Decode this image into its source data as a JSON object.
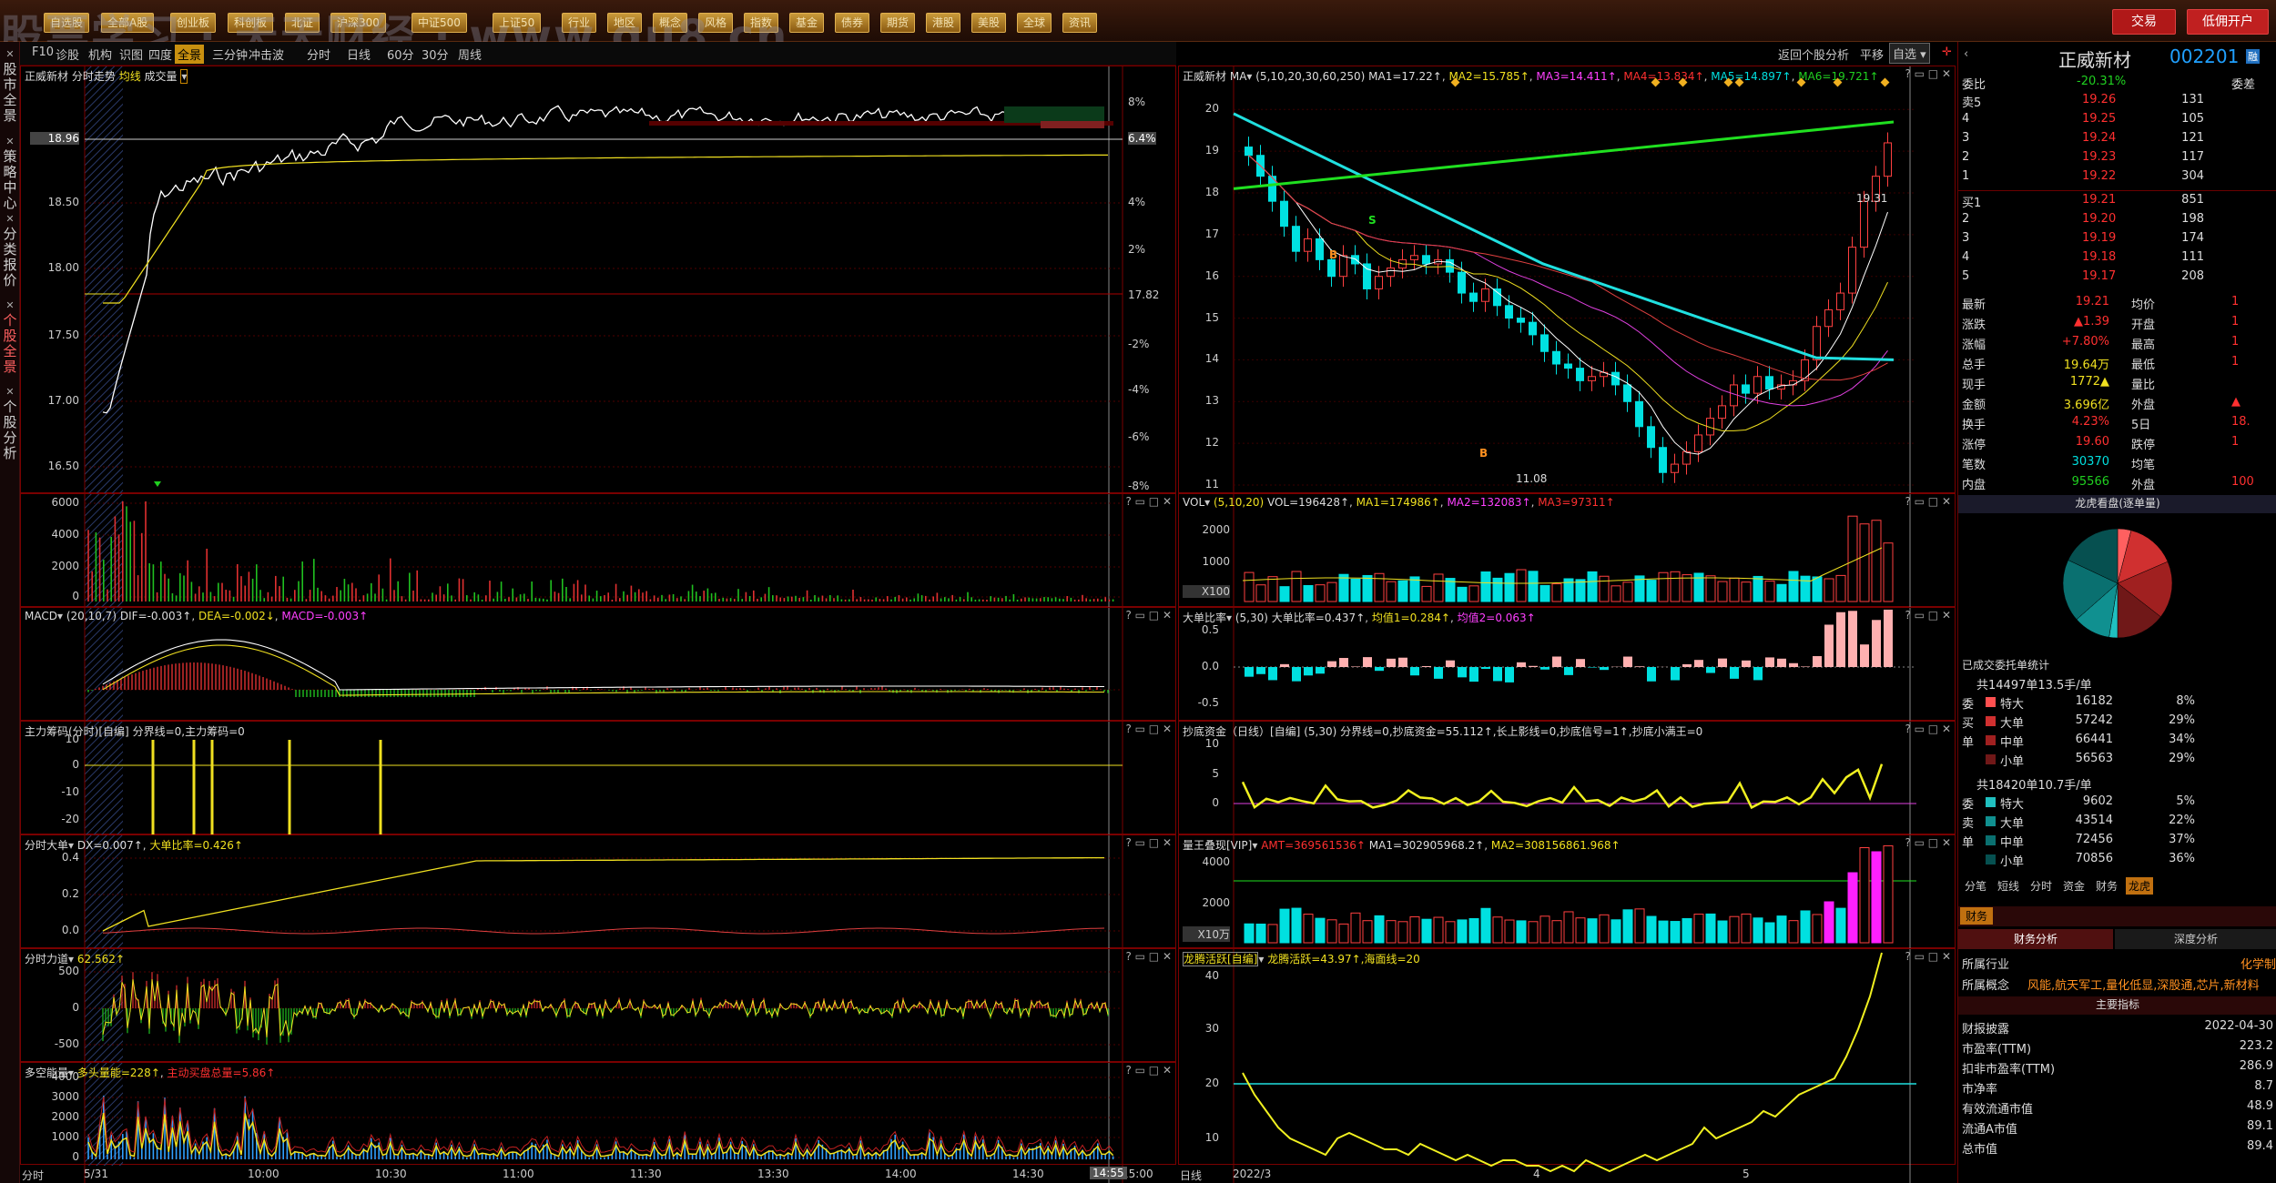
{
  "top": {
    "watermark": "股票学习 · 天天财经 · www.gu8.cn",
    "buttons": [
      "自选股",
      "全部A股",
      "创业板",
      "科创板",
      "北证",
      "沪深300",
      "中证500",
      "上证50",
      "行业",
      "地区",
      "概念",
      "风格",
      "指数",
      "基金",
      "债券",
      "期货",
      "港股",
      "美股",
      "全球",
      "资讯"
    ],
    "trade": "交易",
    "open_account": "低佣开户"
  },
  "sidebar": {
    "tabs": [
      "股市全景",
      "策略中心",
      "分类报价",
      "个股全景",
      "个股分析"
    ]
  },
  "subbar": {
    "items": [
      "F10",
      "诊股",
      "机构",
      "识图",
      "四度",
      "全景",
      "三分钟",
      "冲击波",
      "分时",
      "日线",
      "60分",
      "30分",
      "周线"
    ],
    "right": [
      "返回个股分析",
      "平移",
      "自选"
    ]
  },
  "left": {
    "main": {
      "title": "正威新材",
      "t1": "分时走势",
      "t2": "均线",
      "t3": "成交量",
      "ylabels": [
        "18.96",
        "18.50",
        "18.00",
        "17.50",
        "17.00",
        "16.50"
      ],
      "rlabels": [
        "8%",
        "6.4%",
        "4%",
        "2%",
        "17.82",
        "-2%",
        "-4%",
        "-6%",
        "-8%"
      ],
      "baseline": "17.82"
    },
    "vol": {
      "ylabels": [
        "6000",
        "4000",
        "2000",
        "0"
      ]
    },
    "macd": {
      "title": "MACD",
      "params": "(20,10,7)",
      "dif": "DIF=-0.003↑",
      "dea": "DEA=-0.002↓",
      "macd": "MACD=-0.003↑"
    },
    "zl": {
      "title": "主力筹码(分时)[自编]",
      "v": "分界线=0,主力筹码=0",
      "ylabels": [
        "10",
        "0",
        "-10",
        "-20"
      ]
    },
    "dd": {
      "title": "分时大单",
      "v1": "DX=0.007↑",
      "v2": "大单比率=0.426↑",
      "ylabels": [
        "0.4",
        "0.2",
        "0.0"
      ]
    },
    "ld": {
      "title": "分时力道",
      "v": "62.562↑",
      "ylabels": [
        "500",
        "0",
        "-500"
      ]
    },
    "dk": {
      "title": "多空能量",
      "v1": "多头量能=228↑",
      "v2": "主动买盘总量=5.86↑",
      "ylabels": [
        "4000",
        "3000",
        "2000",
        "1000",
        "0"
      ]
    },
    "xlabels": [
      "5/31",
      "10:00",
      "10:30",
      "11:00",
      "11:30",
      "13:30",
      "14:00",
      "14:30",
      "15:00"
    ],
    "time_cursor": "14:55",
    "mode": "分时"
  },
  "mid": {
    "kline": {
      "title": "正威新材",
      "ma": "MA",
      "params": "(5,10,20,30,60,250)",
      "ma1": "MA1=17.22↑",
      "ma2": "MA2=15.785↑",
      "ma3": "MA3=14.411↑",
      "ma4": "MA4=13.834↑",
      "ma5": "MA5=14.897↑",
      "ma6": "MA6=19.721↑",
      "ylabels": [
        "20",
        "19",
        "18",
        "17",
        "16",
        "15",
        "14",
        "13",
        "12",
        "11"
      ],
      "high": "19.31",
      "low": "11.08",
      "marks": [
        "B",
        "S",
        "B"
      ]
    },
    "vol": {
      "title": "VOL",
      "params": "(5,10,20)",
      "v": "VOL=196428↑",
      "ma1": "MA1=174986↑",
      "ma2": "MA2=132083↑",
      "ma3": "MA3=97311↑",
      "ylabels": [
        "2000",
        "1000",
        "X100"
      ]
    },
    "ddb": {
      "title": "大单比率",
      "params": "(5,30)",
      "v": "大单比率=0.437↑",
      "m1": "均值1=0.284↑",
      "m2": "均值2=0.063↑",
      "ylabels": [
        "0.5",
        "0.0",
        "-0.5"
      ]
    },
    "cd": {
      "title": "抄底资金（日线）[自编]",
      "params": "(5,30)",
      "v": "分界线=0,抄底资金=55.112↑,长上影线=0,抄底信号=1↑,抄底小满王=0",
      "ylabels": [
        "10",
        "5",
        "0"
      ]
    },
    "lw": {
      "title": "量王叠现[VIP]",
      "v1": "AMT=369561536↑",
      "v2": "MA1=302905968.2↑",
      "v3": "MA2=308156861.968↑",
      "ylabels": [
        "4000",
        "2000",
        "X10万"
      ]
    },
    "lt": {
      "title": "龙腾活跃[自编]",
      "v": "龙腾活跃=43.97↑,海面线=20",
      "ylabels": [
        "40",
        "30",
        "20",
        "10"
      ]
    },
    "xlabels": [
      "2022/3",
      "4",
      "5"
    ],
    "mode": "日线"
  },
  "right": {
    "name": "正威新材",
    "code": "002201",
    "wb_label": "委比",
    "wb": "-20.31%",
    "wc_label": "委差",
    "sell": [
      {
        "l": "卖5",
        "p": "19.26",
        "v": "131"
      },
      {
        "l": "4",
        "p": "19.25",
        "v": "105"
      },
      {
        "l": "3",
        "p": "19.24",
        "v": "121"
      },
      {
        "l": "2",
        "p": "19.23",
        "v": "117"
      },
      {
        "l": "1",
        "p": "19.22",
        "v": "304"
      }
    ],
    "buy": [
      {
        "l": "买1",
        "p": "19.21",
        "v": "851"
      },
      {
        "l": "2",
        "p": "19.20",
        "v": "198"
      },
      {
        "l": "3",
        "p": "19.19",
        "v": "174"
      },
      {
        "l": "4",
        "p": "19.18",
        "v": "111"
      },
      {
        "l": "5",
        "p": "19.17",
        "v": "208"
      }
    ],
    "quote": [
      [
        "最新",
        "19.21",
        "均价",
        "1"
      ],
      [
        "涨跌",
        "▲1.39",
        "开盘",
        "1"
      ],
      [
        "涨幅",
        "+7.80%",
        "最高",
        "1"
      ],
      [
        "总手",
        "19.64万",
        "最低",
        "1"
      ],
      [
        "现手",
        "1772▲",
        "量比",
        ""
      ],
      [
        "金额",
        "3.696亿",
        "外盘",
        "▲"
      ],
      [
        "换手",
        "4.23%",
        "5日",
        "18."
      ],
      [
        "涨停",
        "19.60",
        "跌停",
        "1"
      ],
      [
        "笔数",
        "30370",
        "均笔",
        ""
      ],
      [
        "内盘",
        "95566",
        "外盘",
        "100"
      ]
    ],
    "pie_title": "龙虎看盘(逐单量)",
    "pie": [
      {
        "name": "委托特大",
        "value": 8,
        "color": "#ff6060"
      },
      {
        "name": "委托大单",
        "value": 29,
        "color": "#d03030"
      },
      {
        "name": "委托中单",
        "value": 34,
        "color": "#a02020"
      },
      {
        "name": "委托小单",
        "value": 29,
        "color": "#701818"
      }
    ],
    "pie_b": [
      {
        "name": "成交特大",
        "value": 5,
        "color": "#20c0c0"
      },
      {
        "name": "成交大单",
        "value": 22,
        "color": "#109090"
      },
      {
        "name": "成交中单",
        "value": 37,
        "color": "#0a7070"
      },
      {
        "name": "成交小单",
        "value": 36,
        "color": "#065050"
      }
    ],
    "stat_title": "已成交委托单统计",
    "g1": {
      "head": "共14497单13.5手/单",
      "rows": [
        [
          "特大",
          "16182",
          "8%"
        ],
        [
          "大单",
          "57242",
          "29%"
        ],
        [
          "中单",
          "66441",
          "34%"
        ],
        [
          "小单",
          "56563",
          "29%"
        ]
      ],
      "side": [
        "委",
        "买",
        "单"
      ]
    },
    "g2": {
      "head": "共18420单10.7手/单",
      "rows": [
        [
          "特大",
          "9602",
          "5%"
        ],
        [
          "大单",
          "43514",
          "22%"
        ],
        [
          "中单",
          "72456",
          "37%"
        ],
        [
          "小单",
          "70856",
          "36%"
        ]
      ],
      "side": [
        "委",
        "卖",
        "单"
      ]
    },
    "tabs": [
      "分笔",
      "短线",
      "分时",
      "资金",
      "财务",
      "龙虎"
    ],
    "fin_tab": "财务",
    "fin_tabs": [
      "财务分析",
      "深度分析"
    ],
    "industry_l": "所属行业",
    "industry": "化学制",
    "concept_l": "所属概念",
    "concept": "风能,航天军工,量化低显,深股通,芯片,新材料",
    "key": "主要指标",
    "fin": [
      [
        "财报披露",
        "2022-04-30"
      ],
      [
        "市盈率(TTM)",
        "223.2"
      ],
      [
        "扣非市盈率(TTM)",
        "286.9"
      ],
      [
        "市净率",
        "8.7"
      ],
      [
        "有效流通市值",
        "48.9"
      ],
      [
        "流通A市值",
        "89.1"
      ],
      [
        "总市值",
        "89.4"
      ]
    ]
  }
}
